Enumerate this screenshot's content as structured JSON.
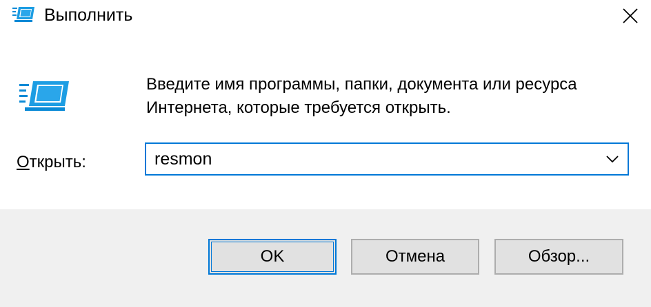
{
  "window": {
    "title": "Выполнить",
    "title_icon": "run-icon",
    "close_icon": "close-icon"
  },
  "content": {
    "icon": "run-icon",
    "description_line1": "Введите имя программы, папки, документа или ресурса",
    "description_line2": "Интернета, которые требуется открыть.",
    "open_label_accel": "О",
    "open_label_rest": "ткрыть:",
    "input_value": "resmon",
    "dropdown_icon": "chevron-down-icon"
  },
  "buttons": {
    "ok": "OK",
    "cancel": "Отмена",
    "browse": "Обзор..."
  },
  "colors": {
    "accent": "#0078d7",
    "footer_bg": "#f0f0f0",
    "button_bg": "#e1e1e1",
    "button_border": "#adadad"
  }
}
